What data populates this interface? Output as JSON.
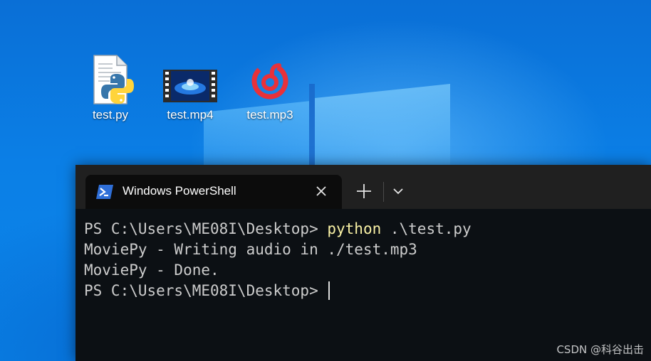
{
  "desktop": {
    "icons": [
      {
        "label": "test.py",
        "icon": "python-file-icon"
      },
      {
        "label": "test.mp4",
        "icon": "video-file-icon"
      },
      {
        "label": "test.mp3",
        "icon": "netease-music-icon"
      }
    ]
  },
  "terminal": {
    "tab": {
      "title": "Windows PowerShell",
      "icon": "powershell-icon"
    },
    "lines": [
      {
        "prompt": "PS C:\\Users\\ME08I\\Desktop> ",
        "command": "python",
        "args": " .\\test.py"
      },
      {
        "text": "MoviePy - Writing audio in ./test.mp3"
      },
      {
        "text": "MoviePy - Done."
      },
      {
        "prompt": "PS C:\\Users\\ME08I\\Desktop> "
      }
    ]
  },
  "watermark": "CSDN @科谷出击",
  "colors": {
    "desktop_blue": "#0b7fe6",
    "command_yellow": "#f9f1a5",
    "console_text": "#cccccc"
  }
}
